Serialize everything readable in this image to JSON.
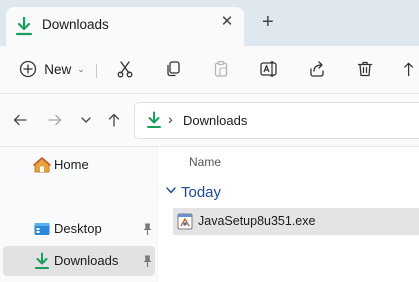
{
  "tab": {
    "title": "Downloads",
    "close_glyph": "✕",
    "new_tab_glyph": "+",
    "icon": "download-arrow-icon"
  },
  "toolbar": {
    "new_label": "New",
    "new_chevron": "⌄",
    "buttons": [
      "cut-icon",
      "copy-icon",
      "paste-icon",
      "rename-icon",
      "share-icon",
      "delete-icon",
      "sort-icon"
    ]
  },
  "navigation": {
    "back_icon": "back-arrow-icon",
    "forward_icon": "forward-arrow-icon",
    "recent_icon": "chevron-down-icon",
    "up_icon": "up-arrow-icon"
  },
  "address": {
    "separator": "›",
    "location": "Downloads"
  },
  "sidebar": {
    "items": [
      {
        "label": "Home",
        "icon": "home-icon",
        "pinned": false,
        "selected": false
      },
      {
        "label": "Desktop",
        "icon": "desktop-folder-icon",
        "pinned": true,
        "selected": false
      },
      {
        "label": "Downloads",
        "icon": "download-arrow-icon",
        "pinned": true,
        "selected": true
      }
    ]
  },
  "content": {
    "column_header": "Name",
    "group": "Today",
    "files": [
      {
        "name": "JavaSetup8u351.exe",
        "icon": "installer-file-icon",
        "selected": true
      }
    ]
  },
  "colors": {
    "title_bar": "#dfe7ef",
    "accent_green": "#1a9e5c",
    "group_header": "#1a4a9c",
    "selection": "#e4e4e4"
  }
}
